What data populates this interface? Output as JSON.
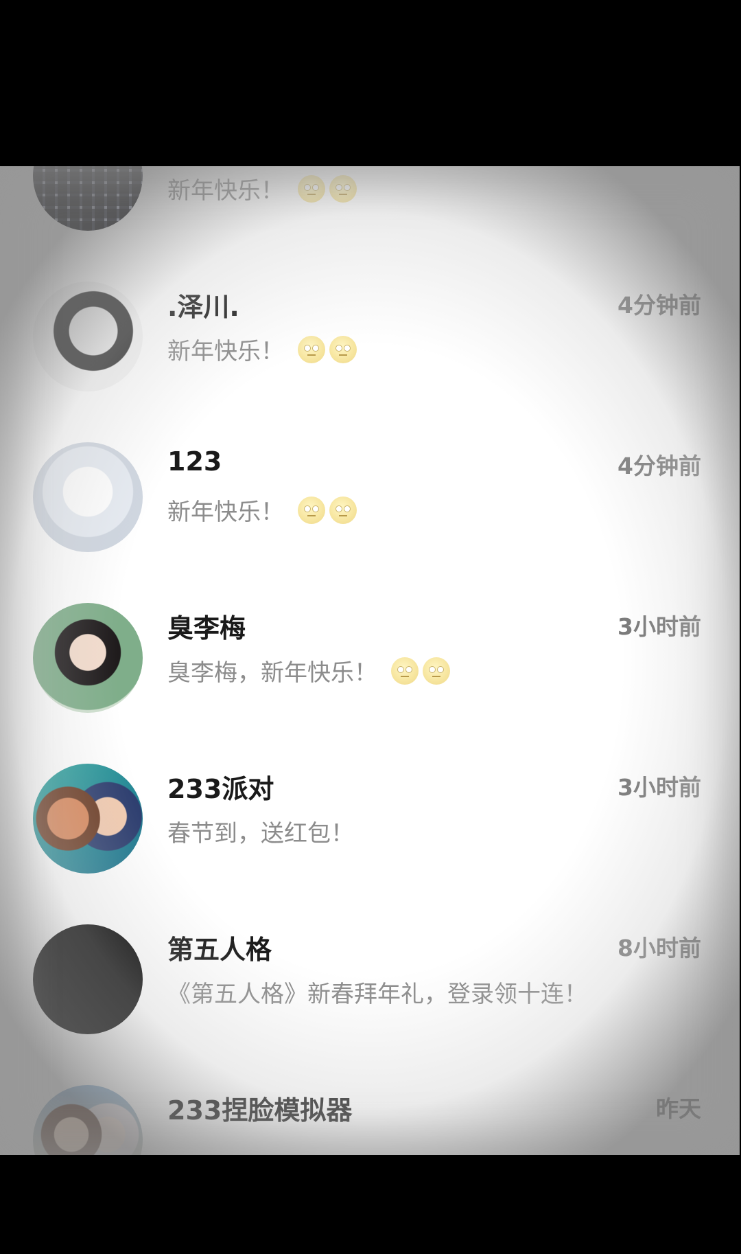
{
  "conversations": [
    {
      "name": "",
      "time": "",
      "message": "新年快乐！",
      "emoji_count": 2,
      "avatar_icon": "plaid-shirt-avatar-icon"
    },
    {
      "name": ".泽川.",
      "time": "4分钟前",
      "message": "新年快乐！",
      "emoji_count": 2,
      "avatar_icon": "anime-boy-sketch-avatar-icon"
    },
    {
      "name": "123",
      "time": "4分钟前",
      "message": "新年快乐！",
      "emoji_count": 2,
      "avatar_icon": "white-doll-avatar-icon"
    },
    {
      "name": "臭李梅",
      "time": "3小时前",
      "message": "臭李梅，新年快乐！",
      "emoji_count": 2,
      "avatar_icon": "costume-girl-avatar-icon"
    },
    {
      "name": "233派对",
      "time": "3小时前",
      "message": "春节到，送红包！",
      "emoji_count": 0,
      "avatar_icon": "cartoon-duo-avatar-icon"
    },
    {
      "name": "第五人格",
      "time": "8小时前",
      "message": "《第五人格》新春拜年礼，登录领十连！",
      "emoji_count": 0,
      "avatar_icon": "black-avatar-icon"
    },
    {
      "name": "233捏脸模拟器",
      "time": "昨天",
      "message": "",
      "emoji_count": 0,
      "avatar_icon": "anime-pair-avatar-icon"
    }
  ],
  "emoji_name": "eye-roll-emoji-icon",
  "colors": {
    "name": "#1a1a1a",
    "time": "#7a7a7a",
    "message": "#8c8c8c",
    "background": "#ffffff"
  }
}
